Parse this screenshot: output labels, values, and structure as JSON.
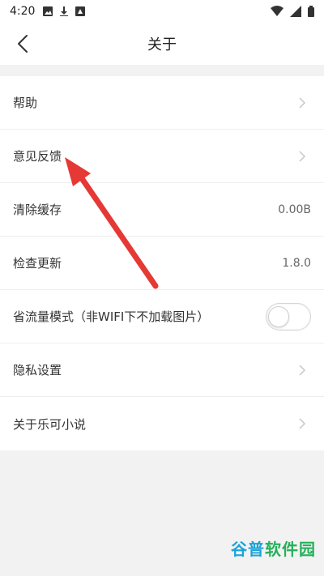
{
  "status_bar": {
    "time": "4:20",
    "left_icons": [
      "image-icon",
      "download-icon",
      "app-icon"
    ],
    "right_icons": [
      "wifi-icon",
      "signal-icon",
      "battery-icon"
    ]
  },
  "header": {
    "title": "关于",
    "back_icon": "chevron-left-icon"
  },
  "settings": [
    {
      "id": "help",
      "label": "帮助",
      "type": "chevron"
    },
    {
      "id": "feedback",
      "label": "意见反馈",
      "type": "chevron"
    },
    {
      "id": "clear-cache",
      "label": "清除缓存",
      "type": "value",
      "value": "0.00B"
    },
    {
      "id": "check-update",
      "label": "检查更新",
      "type": "value",
      "value": "1.8.0"
    },
    {
      "id": "data-saver",
      "label": "省流量模式（非WIFI下不加载图片）",
      "type": "toggle",
      "enabled": false
    },
    {
      "id": "privacy",
      "label": "隐私设置",
      "type": "chevron"
    },
    {
      "id": "about-app",
      "label": "关于乐可小说",
      "type": "chevron"
    }
  ],
  "annotation": {
    "type": "arrow",
    "color": "#e53935"
  },
  "watermark": {
    "part1": "谷普",
    "part2": "软件园"
  }
}
